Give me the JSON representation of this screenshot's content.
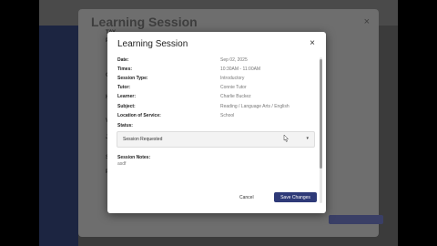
{
  "background": {
    "dialog_title": "Learning Session",
    "close_glyph": "×",
    "fragments": [
      "TAY",
      "P",
      "C",
      "H",
      "V",
      "J",
      "S",
      "P"
    ]
  },
  "modal": {
    "title": "Learning Session",
    "close_glyph": "×",
    "fields": [
      {
        "label": "Date:",
        "value": "Sep 02, 2025"
      },
      {
        "label": "Times:",
        "value": "10:30AM - 11:00AM"
      },
      {
        "label": "Session Type:",
        "value": "Introductory"
      },
      {
        "label": "Tutor:",
        "value": "Connie Tutor"
      },
      {
        "label": "Learner:",
        "value": "Charlie Buckez"
      },
      {
        "label": "Subject:",
        "value": "Reading / Language Arts / English"
      },
      {
        "label": "Location of Service:",
        "value": "School"
      }
    ],
    "status_label": "Status:",
    "status_value": "Session Requested",
    "notes_label": "Session Notes:",
    "notes_value": "asdf",
    "cancel_label": "Cancel",
    "save_label": "Save Changes"
  },
  "icons": {
    "close": "close-icon",
    "dropdown": "chevron-down-icon",
    "cursor": "mouse-pointer-icon"
  },
  "colors": {
    "primary": "#2e3a78",
    "sidebar": "#1c2541"
  }
}
